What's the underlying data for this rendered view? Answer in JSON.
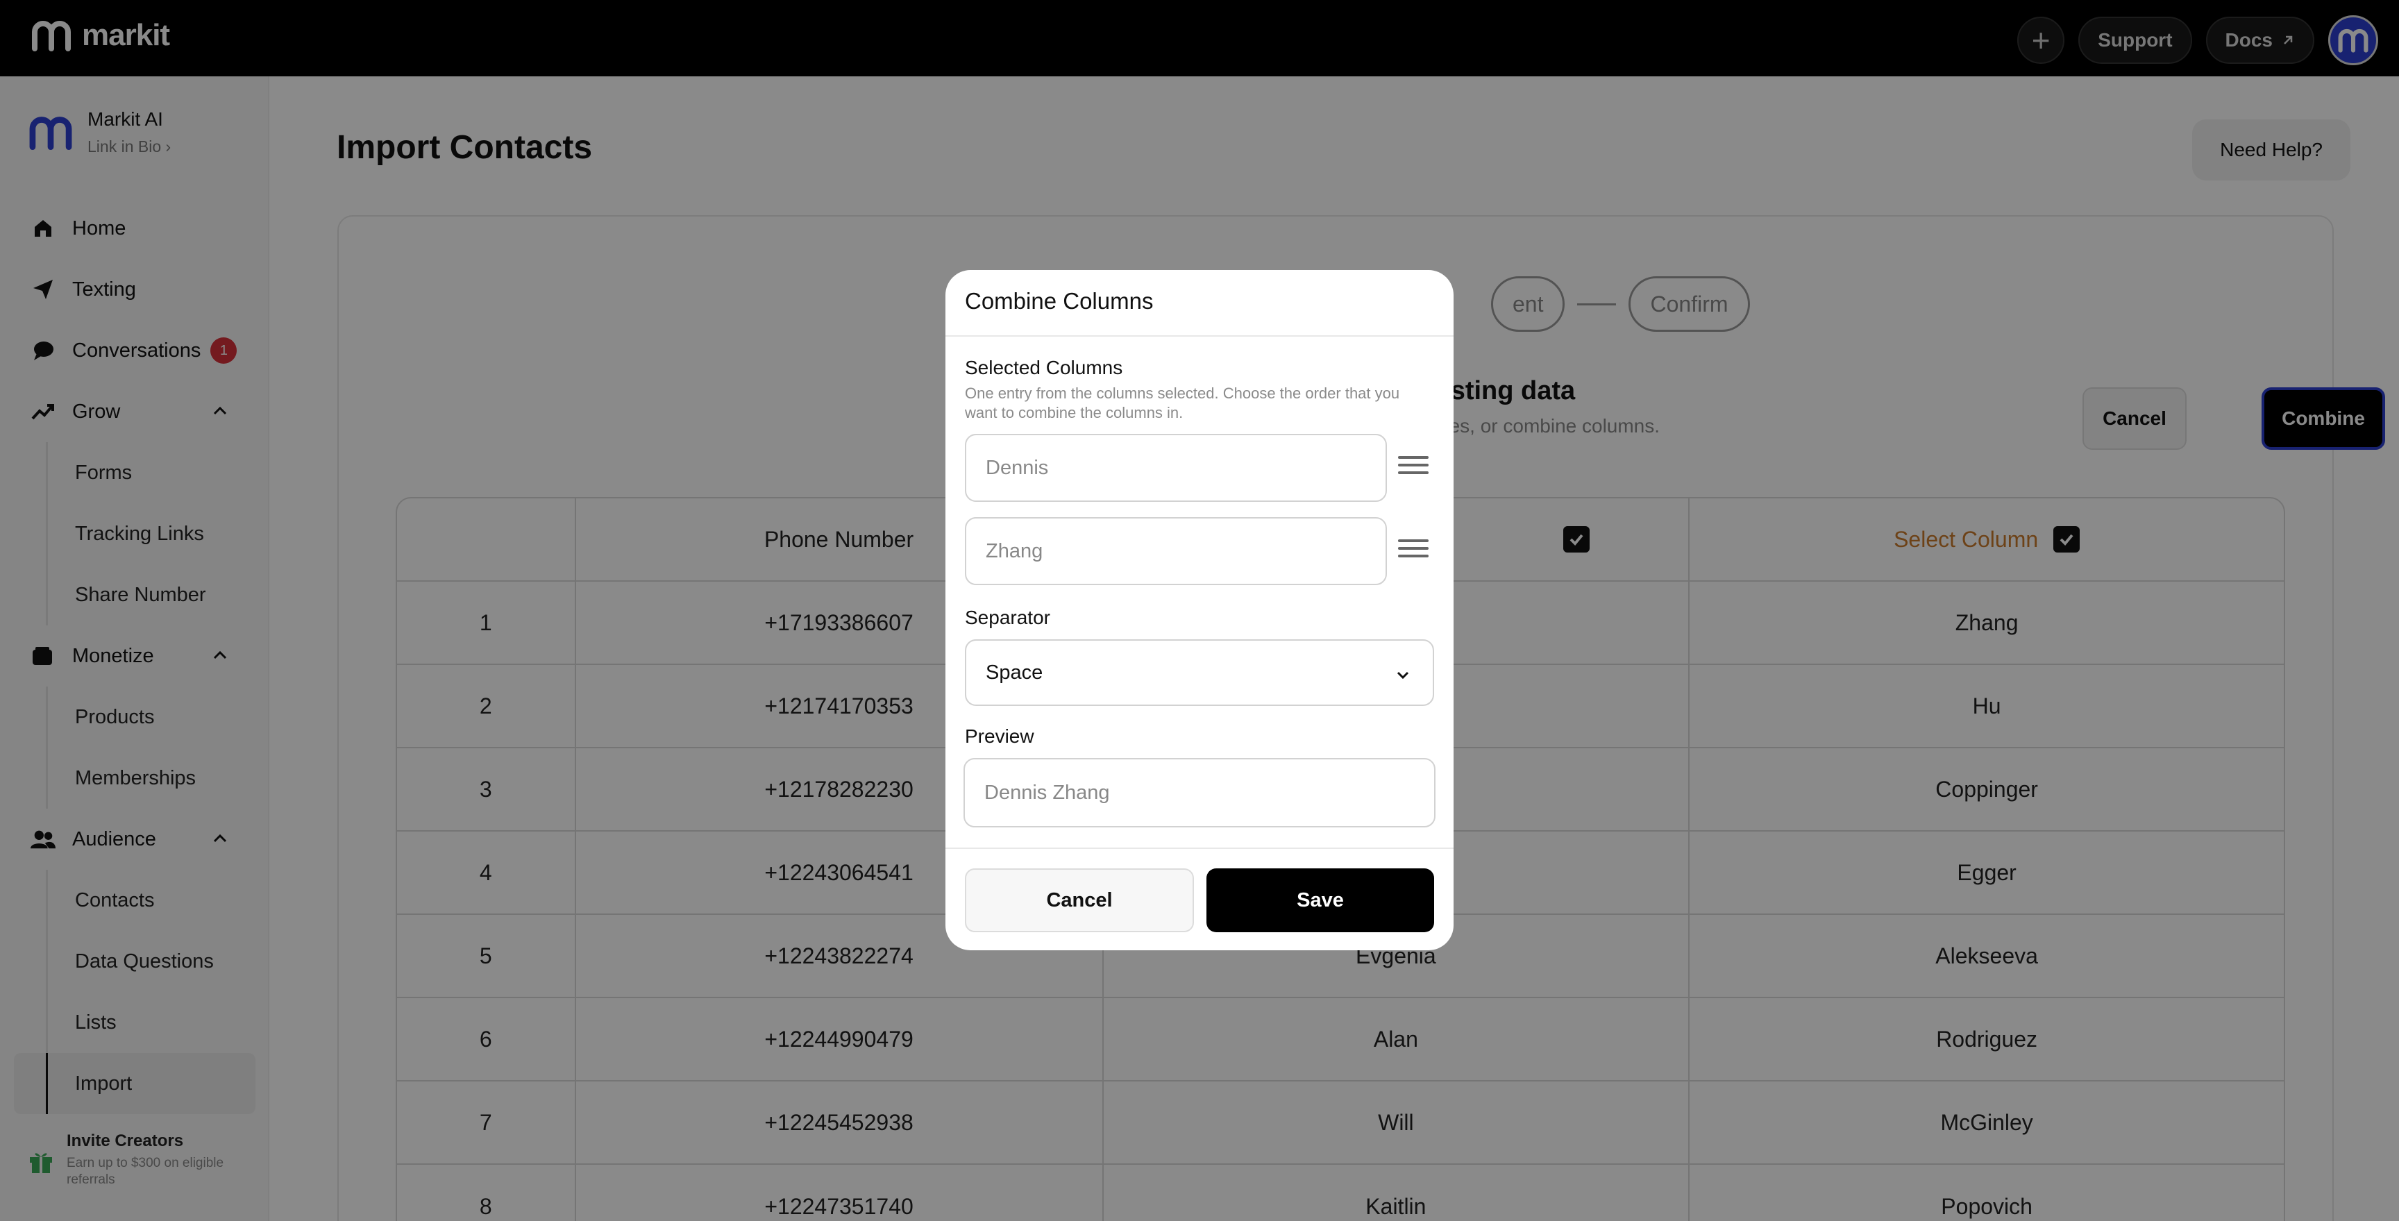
{
  "topbar": {
    "brand": "markit",
    "plus_icon": "plus-icon",
    "support_label": "Support",
    "docs_label": "Docs",
    "docs_icon": "external-link-icon"
  },
  "sidebar": {
    "account_name": "Markit AI",
    "account_sub": "Link in Bio",
    "items": [
      {
        "label": "Home",
        "icon": "home-icon"
      },
      {
        "label": "Texting",
        "icon": "send-icon"
      },
      {
        "label": "Conversations",
        "icon": "chat-icon",
        "badge": "1"
      },
      {
        "label": "Grow",
        "icon": "trend-up-icon"
      },
      {
        "label": "Monetize",
        "icon": "wallet-icon"
      },
      {
        "label": "Audience",
        "icon": "people-icon"
      }
    ],
    "grow_sub": [
      "Forms",
      "Tracking Links",
      "Share Number"
    ],
    "monetize_sub": [
      "Products",
      "Memberships"
    ],
    "audience_sub": [
      "Contacts",
      "Data Questions",
      "Lists",
      "Import"
    ],
    "invite_title": "Invite Creators",
    "invite_sub": "Earn up to $300 on eligible referrals"
  },
  "main": {
    "title": "Import Contacts",
    "help_label": "Need Help?",
    "steps": [
      "ent",
      "Confirm"
    ],
    "heading": "xisting data",
    "subheading": "ypes, or combine columns.",
    "cancel_label": "Cancel",
    "combine_label": "Combine",
    "table": {
      "headers": [
        "",
        "Phone Number",
        "",
        "Select Column"
      ],
      "rows": [
        [
          "1",
          "+17193386607",
          "",
          "Zhang"
        ],
        [
          "2",
          "+12174170353",
          "",
          "Hu"
        ],
        [
          "3",
          "+12178282230",
          "",
          "Coppinger"
        ],
        [
          "4",
          "+12243064541",
          "",
          "Egger"
        ],
        [
          "5",
          "+12243822274",
          "Evgenia",
          "Alekseeva"
        ],
        [
          "6",
          "+12244990479",
          "Alan",
          "Rodriguez"
        ],
        [
          "7",
          "+12245452938",
          "Will",
          "McGinley"
        ],
        [
          "8",
          "+12247351740",
          "Kaitlin",
          "Popovich"
        ]
      ]
    }
  },
  "modal": {
    "title": "Combine Columns",
    "selected_label": "Selected Columns",
    "selected_desc": "One entry from the columns selected. Choose the order that you want to combine the columns in.",
    "fields": [
      "Dennis",
      "Zhang"
    ],
    "separator_label": "Separator",
    "separator_value": "Space",
    "preview_label": "Preview",
    "preview_value": "Dennis Zhang",
    "cancel_label": "Cancel",
    "save_label": "Save"
  },
  "colors": {
    "brand_blue": "#2d3fd1",
    "badge_red": "#d7313a",
    "header_orange": "#c97a2c"
  }
}
